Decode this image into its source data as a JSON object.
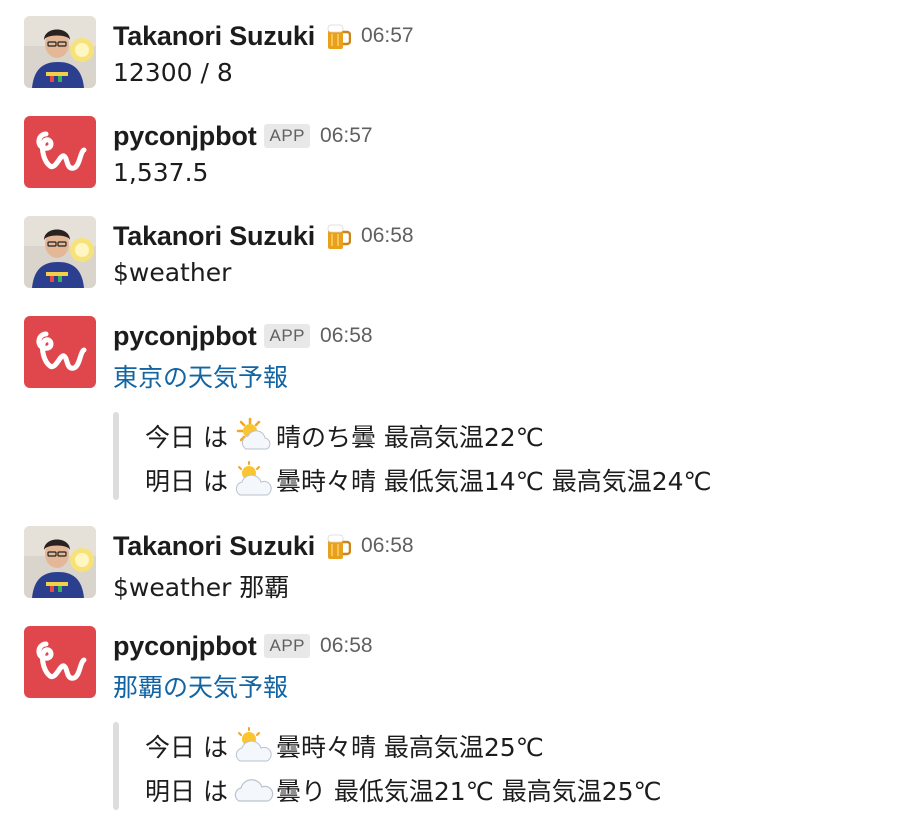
{
  "messages": [
    {
      "user": "Takanori Suzuki",
      "status_emoji": "beer-mug-icon",
      "time": "06:57",
      "text": "12300 / 8"
    },
    {
      "user": "pyconjpbot",
      "badge": "APP",
      "time": "06:57",
      "text": "1,537.5"
    },
    {
      "user": "Takanori Suzuki",
      "status_emoji": "beer-mug-icon",
      "time": "06:58",
      "text": "$weather"
    },
    {
      "user": "pyconjpbot",
      "badge": "APP",
      "time": "06:58",
      "link": "東京の天気予報",
      "lines": [
        {
          "prefix": "今日 は",
          "icon": "sun-behind-cloud-icon",
          "text": "晴のち曇 最高気温22℃"
        },
        {
          "prefix": "明日 は",
          "icon": "cloud-with-sun-icon",
          "text": "曇時々晴 最低気温14℃ 最高気温24℃"
        }
      ]
    },
    {
      "user": "Takanori Suzuki",
      "status_emoji": "beer-mug-icon",
      "time": "06:58",
      "text": "$weather 那覇"
    },
    {
      "user": "pyconjpbot",
      "badge": "APP",
      "time": "06:58",
      "link": "那覇の天気予報",
      "lines": [
        {
          "prefix": "今日 は",
          "icon": "cloud-with-sun-icon",
          "text": "曇時々晴 最高気温25℃"
        },
        {
          "prefix": "明日 は",
          "icon": "cloud-icon",
          "text": "曇り 最低気温21℃ 最高気温25℃"
        }
      ]
    }
  ],
  "colors": {
    "link": "#1264a3",
    "bot_avatar": "#e0474c",
    "timestamp": "#616061",
    "attachment_bar": "#dddddd"
  }
}
